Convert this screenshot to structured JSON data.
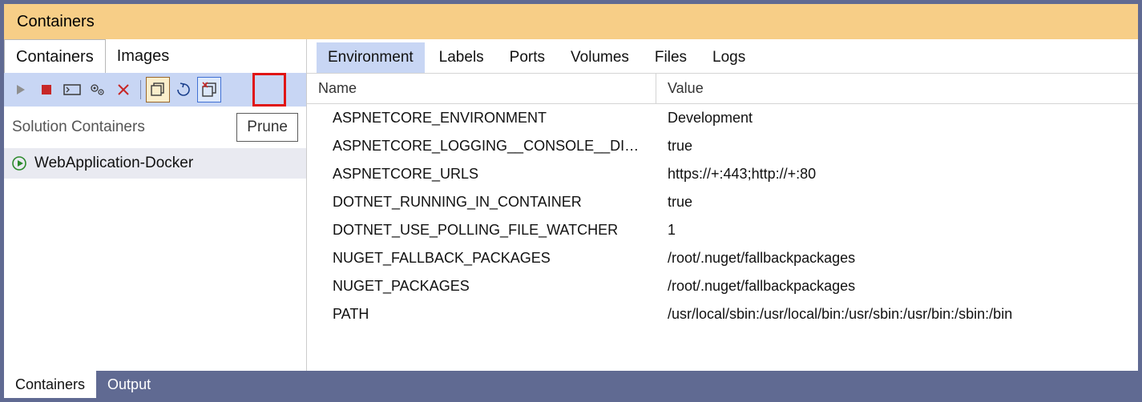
{
  "title": "Containers",
  "left_tabs": [
    "Containers",
    "Images"
  ],
  "left_tab_active": 0,
  "toolbar_tooltip": "Prune",
  "group_label": "Solution Containers",
  "container_list": [
    "WebApplication-Docker"
  ],
  "right_tabs": [
    "Environment",
    "Labels",
    "Ports",
    "Volumes",
    "Files",
    "Logs"
  ],
  "right_tab_active": 0,
  "columns": {
    "name": "Name",
    "value": "Value"
  },
  "env": [
    {
      "name": "ASPNETCORE_ENVIRONMENT",
      "value": "Development"
    },
    {
      "name": "ASPNETCORE_LOGGING__CONSOLE__DISA…",
      "value": "true"
    },
    {
      "name": "ASPNETCORE_URLS",
      "value": "https://+:443;http://+:80"
    },
    {
      "name": "DOTNET_RUNNING_IN_CONTAINER",
      "value": "true"
    },
    {
      "name": "DOTNET_USE_POLLING_FILE_WATCHER",
      "value": "1"
    },
    {
      "name": "NUGET_FALLBACK_PACKAGES",
      "value": "/root/.nuget/fallbackpackages"
    },
    {
      "name": "NUGET_PACKAGES",
      "value": "/root/.nuget/fallbackpackages"
    },
    {
      "name": "PATH",
      "value": "/usr/local/sbin:/usr/local/bin:/usr/sbin:/usr/bin:/sbin:/bin"
    }
  ],
  "bottom_tabs": [
    "Containers",
    "Output"
  ],
  "bottom_tab_active": 0
}
